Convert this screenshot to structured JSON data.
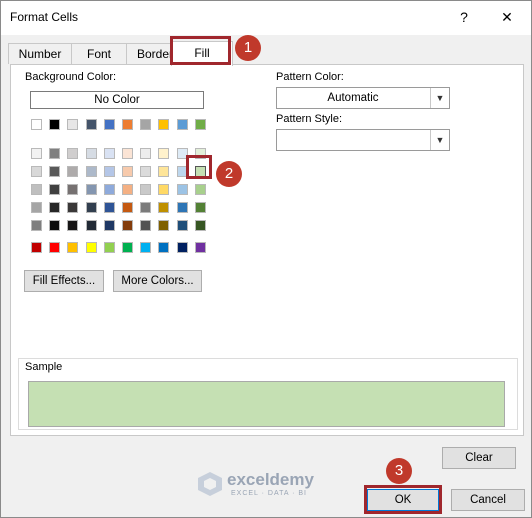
{
  "window": {
    "title": "Format Cells",
    "help": "?",
    "close": "✕"
  },
  "tabs": [
    "Number",
    "Font",
    "Border",
    "Fill"
  ],
  "background_color": {
    "label": "Background Color:",
    "no_color": "No Color",
    "theme_rows": [
      [
        "#ffffff",
        "#000000",
        "#e7e6e6",
        "#44546a",
        "#4472c4",
        "#ed7d31",
        "#a5a5a5",
        "#ffc000",
        "#5b9bd5",
        "#70ad47"
      ],
      [
        "#f2f2f2",
        "#808080",
        "#d0cece",
        "#d6dce4",
        "#d9e2f3",
        "#fbe4d5",
        "#ededed",
        "#fff2cc",
        "#deebf6",
        "#e2efd9"
      ],
      [
        "#d8d8d8",
        "#595959",
        "#aeabab",
        "#adb9ca",
        "#b4c6e7",
        "#f7caac",
        "#dbdbdb",
        "#fee599",
        "#bdd7ee",
        "#c5e0b3"
      ],
      [
        "#bfbfbf",
        "#404040",
        "#767171",
        "#8496b0",
        "#8eaadb",
        "#f4b083",
        "#c9c9c9",
        "#ffd965",
        "#9cc3e5",
        "#a8d08d"
      ],
      [
        "#a5a5a5",
        "#262626",
        "#3a3838",
        "#323f4f",
        "#2f5496",
        "#c45911",
        "#7b7b7b",
        "#bf9000",
        "#2e75b5",
        "#538135"
      ],
      [
        "#7f7f7f",
        "#0c0c0c",
        "#171616",
        "#222a35",
        "#1f3864",
        "#833c0b",
        "#525252",
        "#7f6000",
        "#1f4e79",
        "#375623"
      ]
    ],
    "standard_colors": [
      "#c00000",
      "#ff0000",
      "#ffc000",
      "#ffff00",
      "#92d050",
      "#00b050",
      "#00b0f0",
      "#0070c0",
      "#002060",
      "#7030a0"
    ],
    "selected_color": "#c5e0b3"
  },
  "buttons": {
    "fill_effects": "Fill Effects...",
    "more_colors": "More Colors...",
    "clear": "Clear",
    "ok": "OK",
    "cancel": "Cancel"
  },
  "pattern_color": {
    "label": "Pattern Color:",
    "value": "Automatic"
  },
  "pattern_style": {
    "label": "Pattern Style:",
    "value": ""
  },
  "sample": {
    "label": "Sample",
    "color": "#c5e0b3"
  },
  "badges": [
    "1",
    "2",
    "3"
  ],
  "watermark": {
    "name": "exceldemy",
    "tagline": "EXCEL · DATA · BI"
  }
}
